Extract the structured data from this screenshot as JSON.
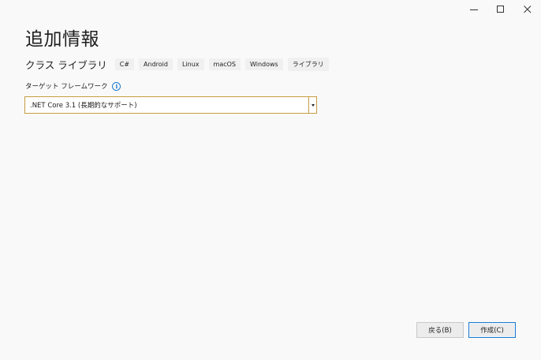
{
  "window": {
    "minimize_symbol": "─",
    "maximize_symbol": "☐",
    "close_symbol": "✕"
  },
  "page": {
    "title": "追加情報"
  },
  "template": {
    "name": "クラス ライブラリ",
    "tags": [
      "C#",
      "Android",
      "Linux",
      "macOS",
      "Windows",
      "ライブラリ"
    ]
  },
  "framework": {
    "label": "ターゲット フレームワーク",
    "info_icon_glyph": "i",
    "selected": ".NET Core 3.1 (長期的なサポート)"
  },
  "footer": {
    "back_label": "戻る(B)",
    "create_label": "作成(C)"
  },
  "colors": {
    "background": "#f9f9f9",
    "select_border": "#c69c42",
    "accent_blue": "#1f7ad1"
  }
}
